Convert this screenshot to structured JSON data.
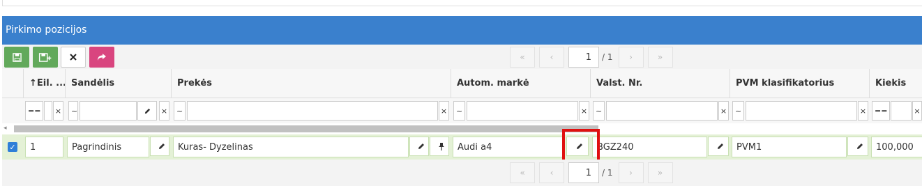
{
  "panel": {
    "title": "Pirkimo pozicijos"
  },
  "toolbar": {
    "save_icon": "floppy-disk-icon",
    "save_add_icon": "floppy-disk-plus-icon",
    "cancel_icon": "close-icon",
    "forward_icon": "share-arrow-icon"
  },
  "pager_top": {
    "first": "«",
    "prev": "‹",
    "page": "1",
    "total": "/ 1",
    "next": "›",
    "last": "»"
  },
  "pager_bottom": {
    "first": "«",
    "prev": "‹",
    "page": "1",
    "total": "/ 1",
    "next": "›",
    "last": "»"
  },
  "columns": {
    "eil": "Eil. ...",
    "sandelis": "Sandėlis",
    "prekes": "Prekės",
    "autom_marke": "Autom. markė",
    "valst_nr": "Valst. Nr.",
    "pvm": "PVM klasifikatorius",
    "kiekis": "Kiekis"
  },
  "filters": {
    "eil_op": "==",
    "sandelis_op": "~",
    "prekes_op": "~",
    "marke_op": "~",
    "valst_op": "~",
    "pvm_op": "~",
    "kiekis_op": "==",
    "clear": "×"
  },
  "row": {
    "selected": true,
    "eil": "1",
    "sandelis": "Pagrindinis",
    "prekes": "Kuras- Dyzelinas",
    "autom_marke": "Audi a4",
    "valst_nr": "BGZ240",
    "pvm": "PVM1",
    "kiekis": "100,000"
  },
  "colors": {
    "header_bg": "#3a80cd",
    "row_selected_bg": "#e4f1d6",
    "highlight": "#e01010"
  }
}
